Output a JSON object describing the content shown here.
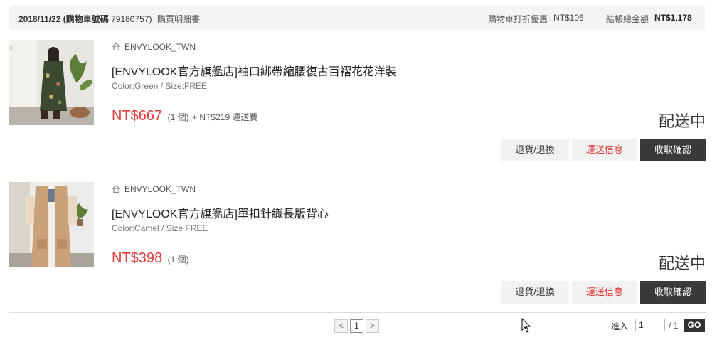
{
  "order": {
    "date": "2018/11/22",
    "cart_label": "(購物車號碼",
    "cart_number": "79180757)",
    "detail_link": "購買明細書",
    "discount_link": "購物車打折優惠",
    "discount_amount": "NT$106",
    "total_label": "結帳總金額",
    "total_amount": "NT$1,178"
  },
  "items": [
    {
      "shop": "ENVYLOOK_TWN",
      "title": "[ENVYLOOK官方旗艦店]袖口綁帶縮腰復古百褶花花洋裝",
      "variant": "Color:Green / Size:FREE",
      "price": "NT$667",
      "qty": "(1 個)",
      "shipping": "+ NT$219 運送費",
      "status": "配送中",
      "buttons": {
        "return": "退貨/退換",
        "track": "運送信息",
        "confirm": "收取確認"
      }
    },
    {
      "shop": "ENVYLOOK_TWN",
      "title": "[ENVYLOOK官方旗艦店]單扣針織長版背心",
      "variant": "Color:Camel / Size:FREE",
      "price": "NT$398",
      "qty": "(1 個)",
      "status": "配送中",
      "buttons": {
        "return": "退貨/退換",
        "track": "運送信息",
        "confirm": "收取確認"
      }
    }
  ],
  "pagination": {
    "prev": "<",
    "current": "1",
    "next": ">",
    "goto_label": "進入",
    "goto_value": "1",
    "goto_total": "/ 1",
    "go_button": "GO"
  },
  "colors": {
    "price": "#e03c3c",
    "confirm_button": "#3a3a3a",
    "track_text": "#dd3333"
  },
  "icons": {
    "shop": "home-icon",
    "pointer": "mouse-cursor"
  }
}
